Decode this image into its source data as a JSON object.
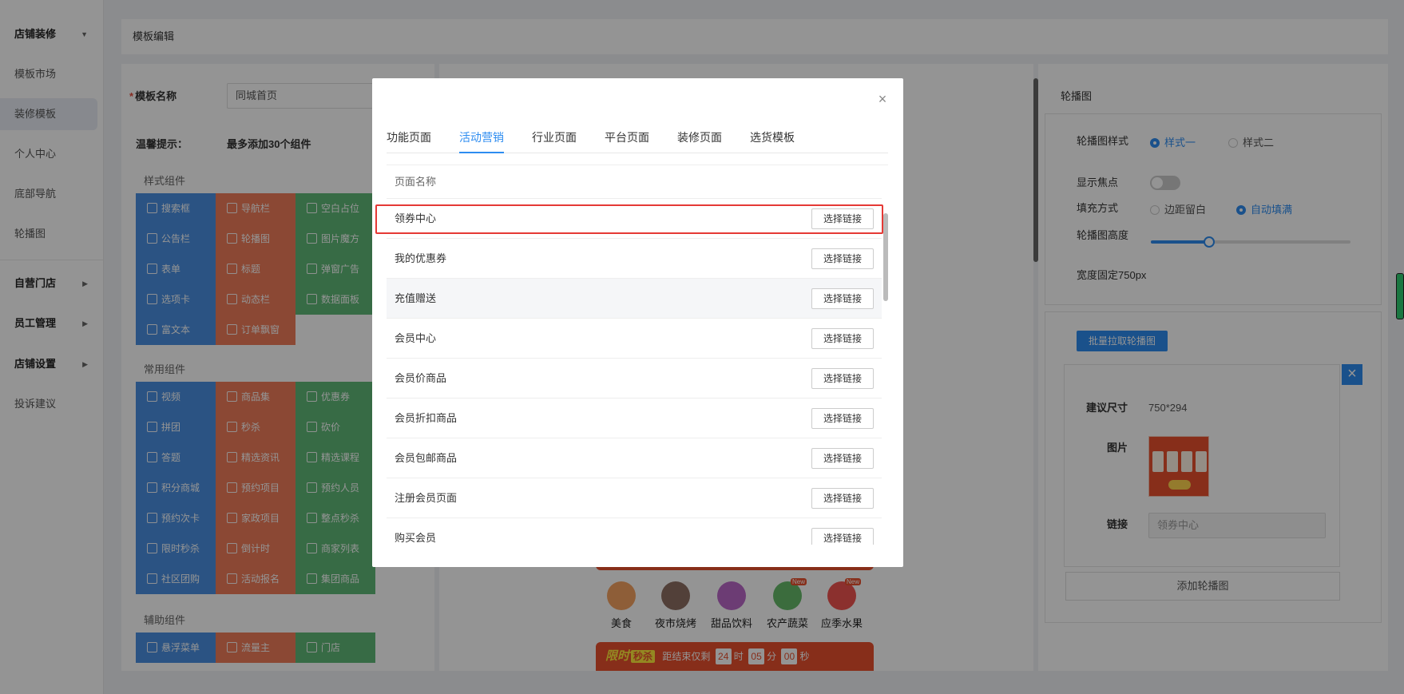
{
  "sidebar": {
    "items": [
      {
        "label": "店铺装修",
        "bold": true,
        "arrow": "▼"
      },
      {
        "label": "模板市场"
      },
      {
        "label": "装修模板"
      },
      {
        "label": "个人中心"
      },
      {
        "label": "底部导航"
      },
      {
        "label": "轮播图"
      },
      {
        "label": "自营门店",
        "bold": true,
        "arrow": "▶"
      },
      {
        "label": "员工管理",
        "bold": true,
        "arrow": "▶"
      },
      {
        "label": "店铺设置",
        "bold": true,
        "arrow": "▶"
      },
      {
        "label": "投诉建议"
      }
    ]
  },
  "header": {
    "title": "模板编辑"
  },
  "editor": {
    "name_label": "模板名称",
    "name_value": "同城首页",
    "tip_label": "温馨提示：",
    "tip_value": "最多添加30个组件"
  },
  "components": {
    "style_title": "样式组件",
    "style_items": [
      "搜索框",
      "导航栏",
      "空白占位",
      "公告栏",
      "轮播图",
      "图片魔方",
      "表单",
      "标题",
      "弹窗广告",
      "选项卡",
      "动态栏",
      "数据面板",
      "富文本",
      "订单飘窗"
    ],
    "common_title": "常用组件",
    "common_items": [
      "视频",
      "商品集",
      "优惠券",
      "拼团",
      "秒杀",
      "砍价",
      "答题",
      "精选资讯",
      "精选课程",
      "积分商城",
      "预约项目",
      "预约人员",
      "预约次卡",
      "家政项目",
      "整点秒杀",
      "限时秒杀",
      "倒计时",
      "商家列表",
      "社区团购",
      "活动报名",
      "集团商品"
    ],
    "aux_title": "辅助组件",
    "aux_items": [
      "悬浮菜单",
      "流量主",
      "门店"
    ]
  },
  "preview": {
    "categories": [
      "美食",
      "夜市烧烤",
      "甜品饮料",
      "农产蔬菜",
      "应季水果"
    ],
    "new_badge": "New",
    "flash_title": "限时",
    "flash_tag": "秒杀",
    "flash_text": "距结束仅剩",
    "countdown": [
      "24",
      "05",
      "00"
    ],
    "units": [
      "时",
      "分",
      "秒"
    ]
  },
  "settings": {
    "title": "轮播图",
    "style_label": "轮播图样式",
    "style_options": [
      "样式一",
      "样式二"
    ],
    "dot_label": "显示焦点",
    "fill_label": "填充方式",
    "fill_options": [
      "边距留白",
      "自动填满"
    ],
    "height_label": "轮播图高度",
    "height_value_fraction": 0.29,
    "width_note": "宽度固定750px",
    "batch_button": "批量拉取轮播图",
    "size_label": "建议尺寸",
    "size_value": "750*294",
    "image_label": "图片",
    "link_label": "链接",
    "link_value": "领券中心",
    "add_button": "添加轮播图"
  },
  "modal": {
    "tabs": [
      "功能页面",
      "活动营销",
      "行业页面",
      "平台页面",
      "装修页面",
      "选货模板"
    ],
    "active_tab": "活动营销",
    "column_header": "页面名称",
    "select_label": "选择链接",
    "rows": [
      "领券中心",
      "我的优惠券",
      "充值赠送",
      "会员中心",
      "会员价商品",
      "会员折扣商品",
      "会员包邮商品",
      "注册会员页面",
      "购买会员"
    ]
  },
  "colors": {
    "accent": "#2d8cf0",
    "highlight": "#e53935",
    "comp_blue": "#4a90e2",
    "comp_orange": "#f07c5a",
    "comp_green": "#5fb878"
  }
}
